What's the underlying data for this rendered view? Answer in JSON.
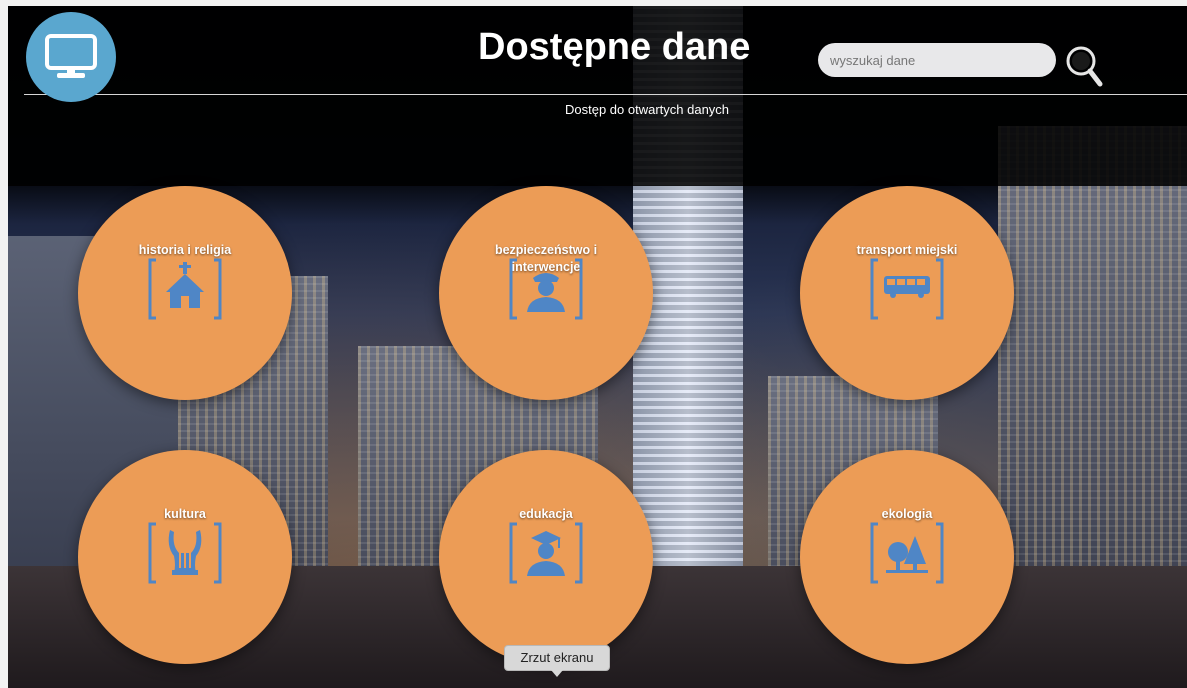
{
  "header": {
    "title": "Dostępne dane",
    "subtitle": "Dostęp do otwartych danych",
    "logo_icon": "monitor-icon"
  },
  "search": {
    "placeholder": "wyszukaj dane",
    "value": "",
    "icon": "search-icon"
  },
  "categories": [
    {
      "label": "historia i religia",
      "icon": "church-icon"
    },
    {
      "label": "bezpieczeństwo i interwencje",
      "icon": "officer-icon"
    },
    {
      "label": "transport miejski",
      "icon": "bus-icon"
    },
    {
      "label": "kultura",
      "icon": "lyre-icon"
    },
    {
      "label": "edukacja",
      "icon": "graduate-icon"
    },
    {
      "label": "ekologia",
      "icon": "trees-icon"
    }
  ],
  "tooltip": {
    "text": "Zrzut ekranu"
  },
  "colors": {
    "category_bg": "#ec9c56",
    "icon_blue": "#4f86c6",
    "logo_bg": "#5aa7cf"
  }
}
